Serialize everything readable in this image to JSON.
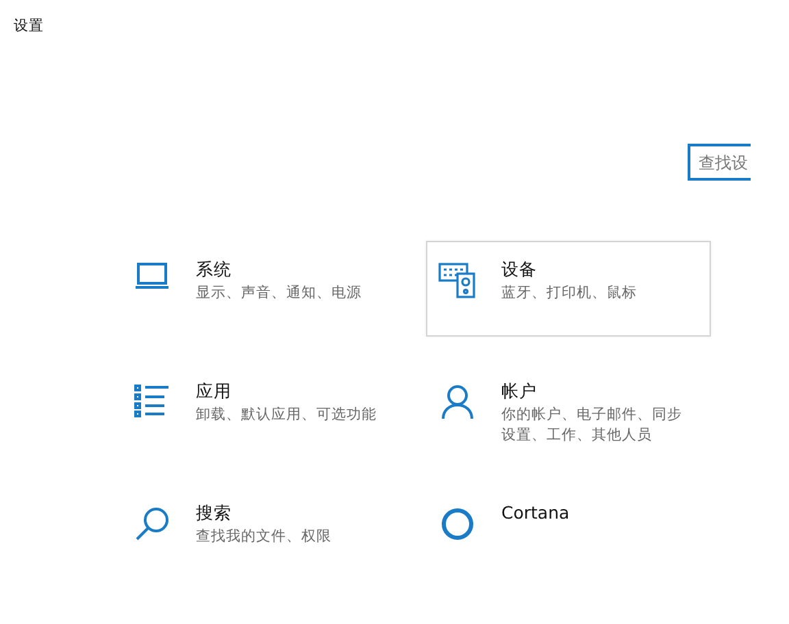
{
  "window": {
    "title": "设置"
  },
  "search": {
    "placeholder": "查找设"
  },
  "categories": [
    {
      "kind": "laptop",
      "name": "系统",
      "description": "显示、声音、通知、电源",
      "hovered": false
    },
    {
      "kind": "devices",
      "name": "设备",
      "description": "蓝牙、打印机、鼠标",
      "hovered": true
    },
    {
      "kind": "apps",
      "name": "应用",
      "description": "卸载、默认应用、可选功能",
      "hovered": false
    },
    {
      "kind": "person",
      "name": "帐户",
      "description": "你的帐户、电子邮件、同步设置、工作、其他人员",
      "hovered": false
    },
    {
      "kind": "search",
      "name": "搜索",
      "description": "查找我的文件、权限",
      "hovered": false
    },
    {
      "kind": "ring",
      "name": "Cortana",
      "hovered": false
    }
  ]
}
